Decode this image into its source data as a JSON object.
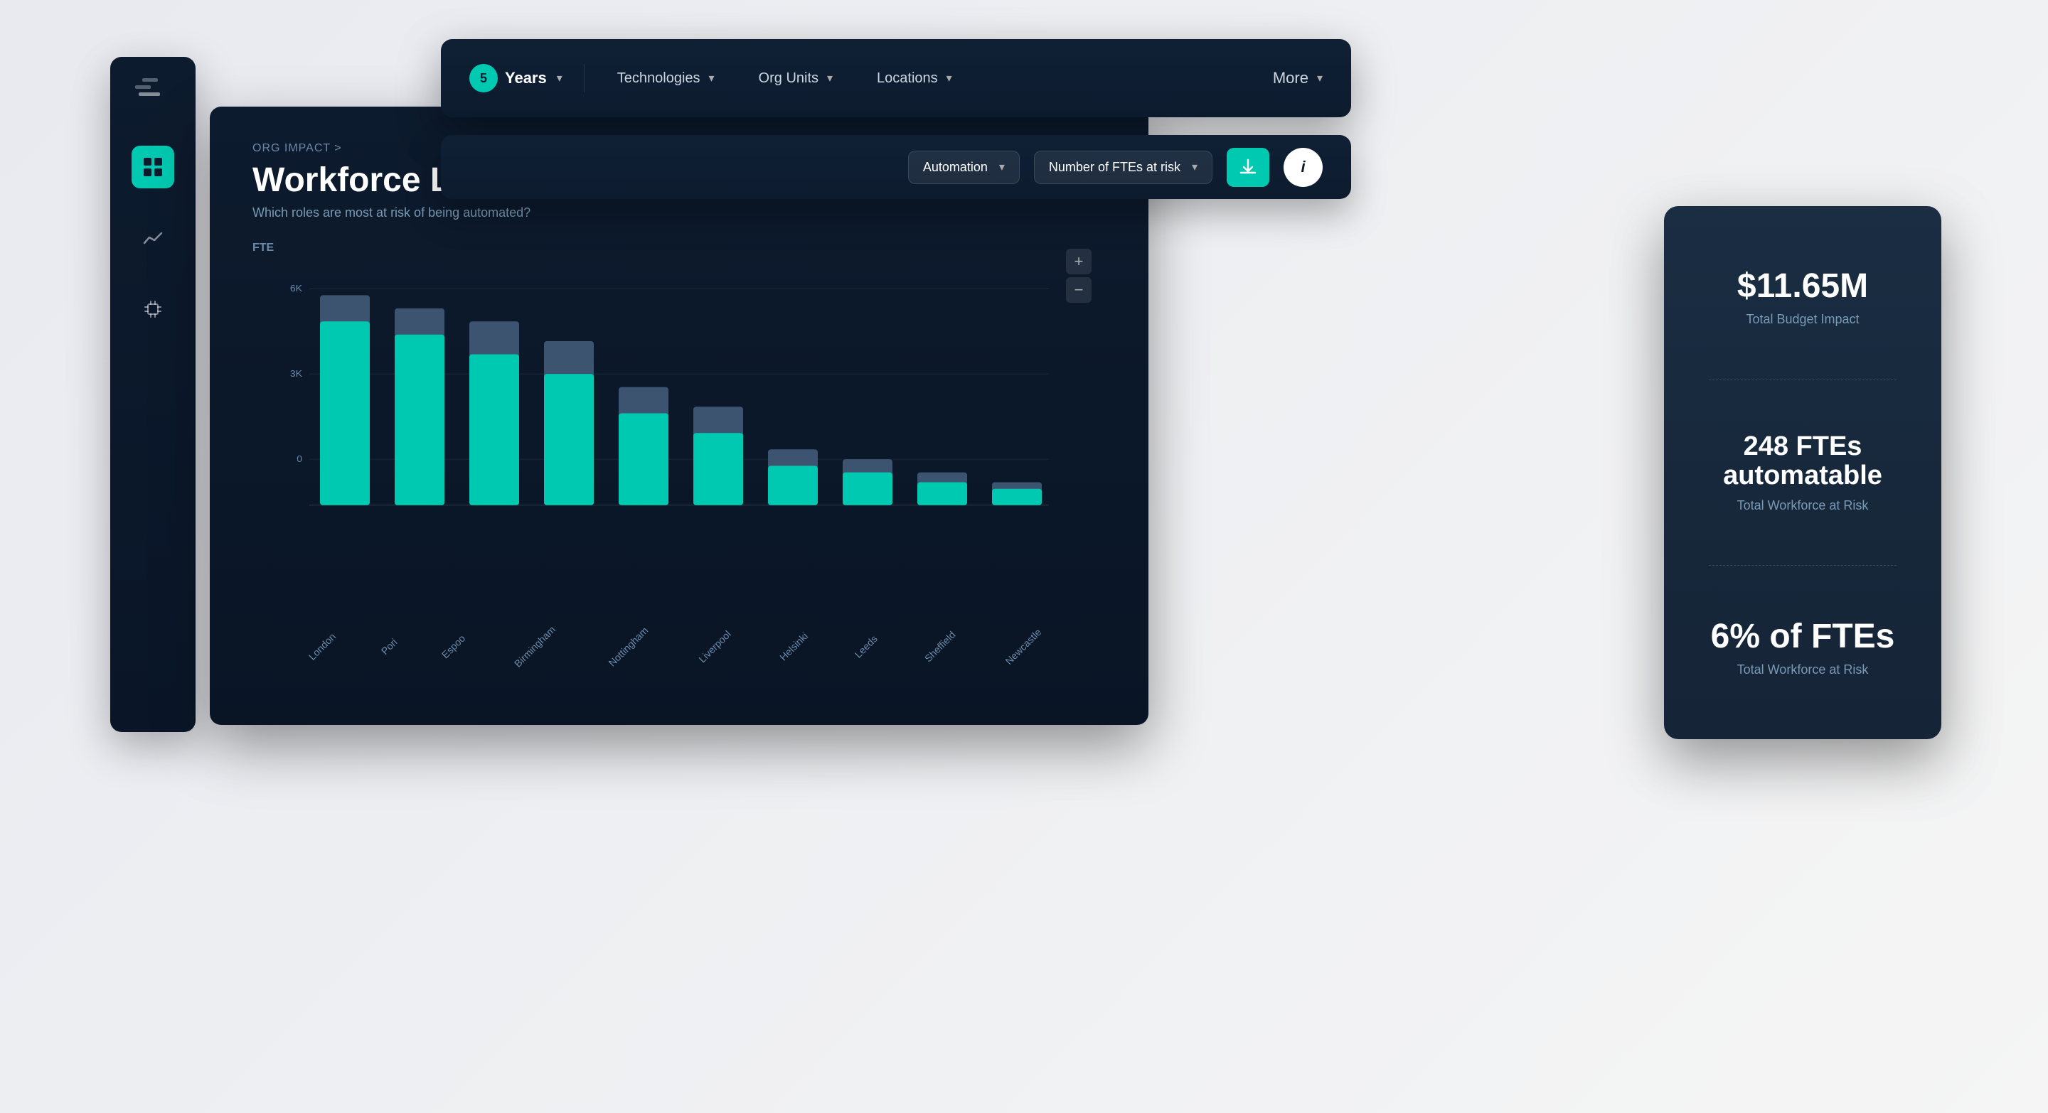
{
  "sidebar": {
    "logo_alt": "logo",
    "icons": [
      {
        "name": "grid-icon",
        "active": true
      },
      {
        "name": "trend-icon",
        "active": false
      },
      {
        "name": "chip-icon",
        "active": false
      }
    ]
  },
  "top_nav": {
    "years_value": "5",
    "years_label": "Years",
    "items": [
      {
        "label": "Technologies"
      },
      {
        "label": "Org Units"
      },
      {
        "label": "Locations"
      }
    ],
    "more_label": "More"
  },
  "filter_bar": {
    "automation_label": "Automation",
    "metric_label": "Number of FTEs at risk",
    "download_label": "Download",
    "info_label": "i"
  },
  "chart": {
    "breadcrumb": "ORG IMPACT >",
    "title": "Workforce Location Impact",
    "subtitle": "Which roles are most at risk of being automated?",
    "y_axis_label": "FTE",
    "y_ticks": [
      "6K",
      "3K",
      "0"
    ],
    "zoom_plus": "+",
    "zoom_minus": "−",
    "bars": [
      {
        "city": "London",
        "teal": 75,
        "gray": 90
      },
      {
        "city": "Pori",
        "teal": 68,
        "gray": 82
      },
      {
        "city": "Espoo",
        "teal": 62,
        "gray": 74
      },
      {
        "city": "Birmingham",
        "teal": 55,
        "gray": 66
      },
      {
        "city": "Nottingham",
        "teal": 38,
        "gray": 50
      },
      {
        "city": "Liverpool",
        "teal": 30,
        "gray": 42
      },
      {
        "city": "Helsinki",
        "teal": 16,
        "gray": 26
      },
      {
        "city": "Leeds",
        "teal": 12,
        "gray": 20
      },
      {
        "city": "Sheffield",
        "teal": 8,
        "gray": 16
      },
      {
        "city": "Newcastle",
        "teal": 6,
        "gray": 14
      }
    ]
  },
  "stats": {
    "budget_value": "$11.65M",
    "budget_label": "Total Budget Impact",
    "ftes_value": "248 FTEs automatable",
    "ftes_label": "Total Workforce at Risk",
    "percent_value": "6% of FTEs",
    "percent_label": "Total Workforce at Risk"
  }
}
